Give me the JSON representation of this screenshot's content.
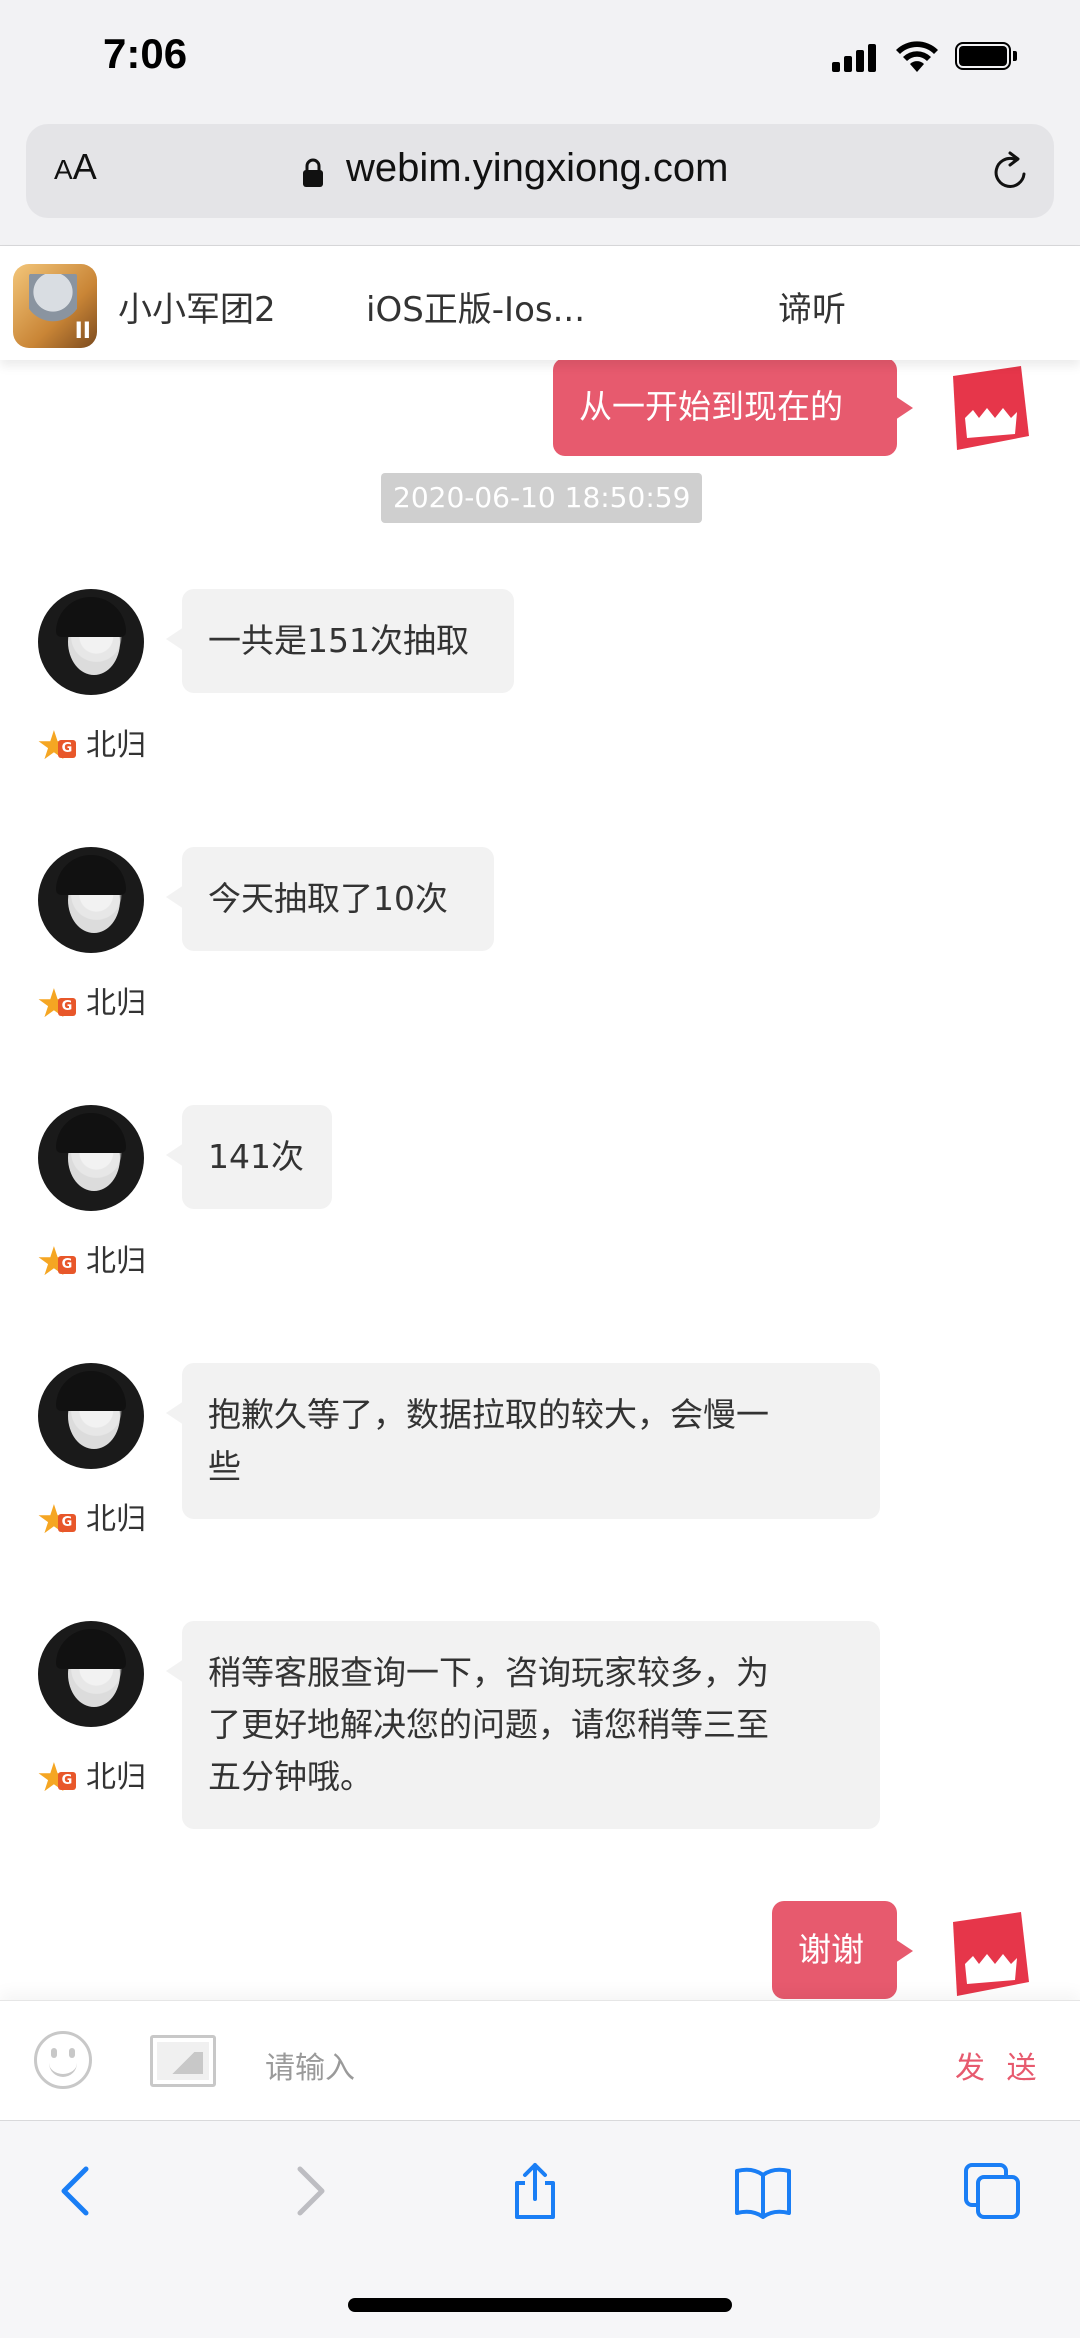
{
  "status_bar": {
    "time": "7:06"
  },
  "browser": {
    "aa_small": "A",
    "aa_large": "A",
    "url": "webim.yingxiong.com"
  },
  "chat_header": {
    "game_name": "小小军团2",
    "platform": "iOS正版-Ios...",
    "mode": "谛听",
    "game_icon_text": "II"
  },
  "messages": {
    "out_1": "从一开始到现在的",
    "timestamp": "2020-06-10 18:50:59",
    "agent_name": "北归",
    "agent_badge_letter": "G",
    "in_1": "一共是151次抽取",
    "in_2": "今天抽取了10次",
    "in_3": "141次",
    "in_4_line1": "抱歉久等了，数据拉取的较大，会慢一",
    "in_4_line2": "些",
    "in_5_line1": "稍等客服查询一下，咨询玩家较多，为",
    "in_5_line2": "了更好地解决您的问题，请您稍等三至",
    "in_5_line3": "五分钟哦。",
    "out_2": "谢谢"
  },
  "input_bar": {
    "placeholder": "请输入",
    "send_label": "发 送"
  },
  "colors": {
    "accent": "#e75a6e",
    "bubble_in": "#f2f2f2",
    "ios_blue": "#1a7ef5"
  }
}
